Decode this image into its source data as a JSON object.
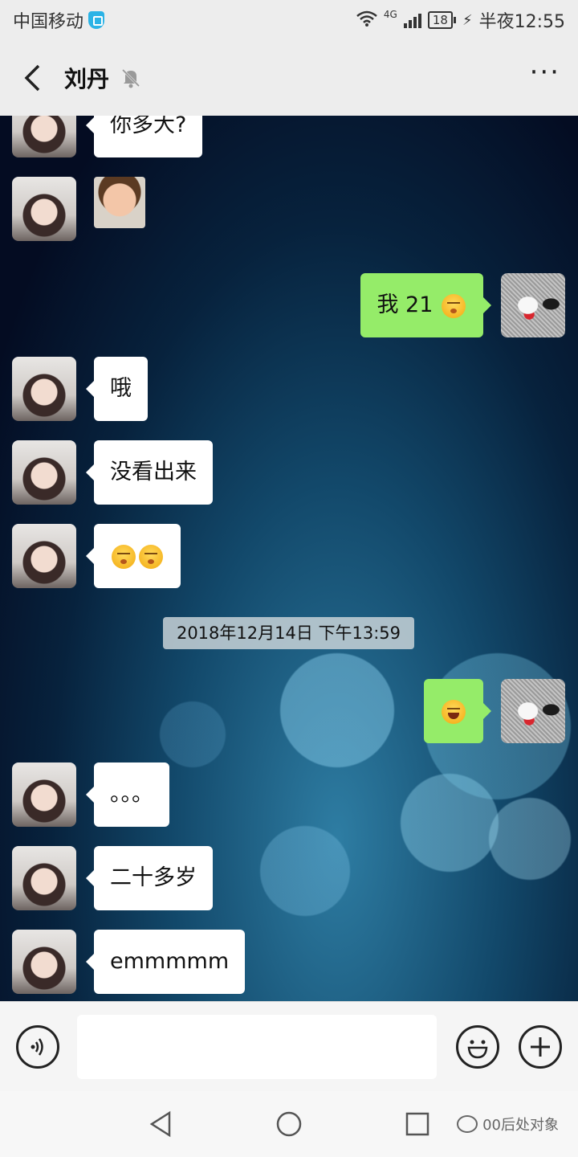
{
  "status_bar": {
    "carrier": "中国移动",
    "network": "4G",
    "battery": "18",
    "time": "半夜12:55"
  },
  "header": {
    "title": "刘丹"
  },
  "messages": [
    {
      "side": "in",
      "text": "你多大?"
    },
    {
      "side": "in",
      "type": "sticker"
    },
    {
      "side": "out",
      "text": "我 21"
    },
    {
      "side": "in",
      "text": "哦"
    },
    {
      "side": "in",
      "text": "没看出来"
    },
    {
      "side": "in",
      "type": "emoji"
    },
    {
      "side": "out",
      "type": "emoji"
    },
    {
      "side": "in",
      "text": "。。。"
    },
    {
      "side": "in",
      "text": "二十多岁"
    },
    {
      "side": "in",
      "text": "emmmmm"
    }
  ],
  "timestamp": "2018年12月14日 下午13:59",
  "input": {
    "placeholder": ""
  },
  "watermark": "00后处对象"
}
